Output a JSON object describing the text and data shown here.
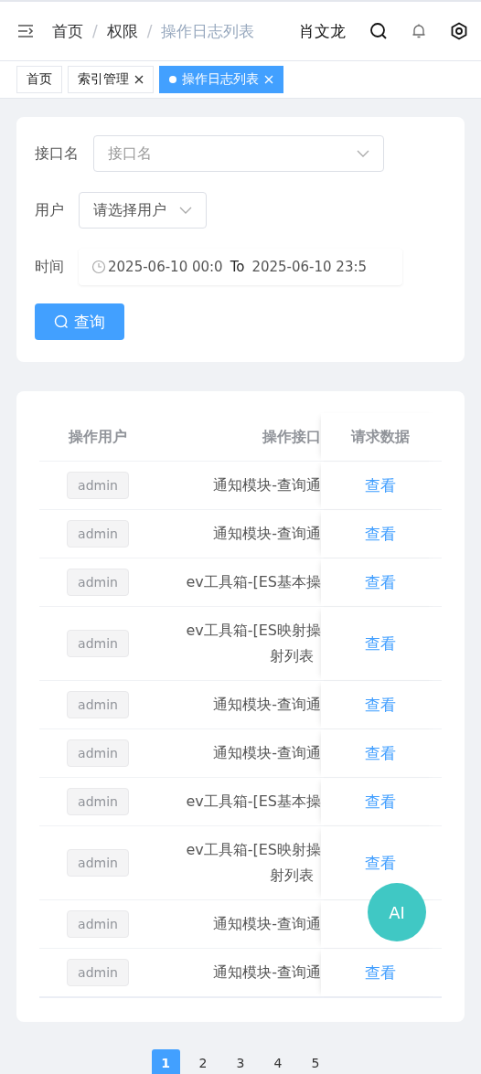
{
  "header": {
    "breadcrumb": [
      {
        "label": "首页",
        "current": false
      },
      {
        "label": "权限",
        "current": false
      },
      {
        "label": "操作日志列表",
        "current": true
      }
    ],
    "separator": "/",
    "user_name": "肖文龙"
  },
  "tabs": [
    {
      "label": "首页",
      "selected": false,
      "closable": false
    },
    {
      "label": "索引管理",
      "selected": false,
      "closable": true
    },
    {
      "label": "操作日志列表",
      "selected": true,
      "closable": true
    }
  ],
  "filters": {
    "fields": [
      {
        "kind": "select",
        "label": "接口名",
        "placeholder": "接口名",
        "wide": true
      },
      {
        "kind": "select",
        "label": "用户",
        "placeholder": "请选择用户",
        "wide": false
      },
      {
        "kind": "daterange",
        "label": "时间",
        "start": "2025-06-10 00:0",
        "separator": "To",
        "end": "2025-06-10 23:5"
      }
    ],
    "search_button": "查询"
  },
  "table": {
    "columns": [
      "操作用户",
      "操作接口",
      "请求数据"
    ],
    "rows": [
      {
        "user": "admin",
        "api": [
          "通知模块-查询通"
        ],
        "action": "查看"
      },
      {
        "user": "admin",
        "api": [
          "通知模块-查询通"
        ],
        "action": "查看"
      },
      {
        "user": "admin",
        "api": [
          "ev工具箱-[ES基本操"
        ],
        "action": "查看"
      },
      {
        "user": "admin",
        "api": [
          "ev工具箱-[ES映射操",
          "射列表"
        ],
        "action": "查看"
      },
      {
        "user": "admin",
        "api": [
          "通知模块-查询通"
        ],
        "action": "查看"
      },
      {
        "user": "admin",
        "api": [
          "通知模块-查询通"
        ],
        "action": "查看"
      },
      {
        "user": "admin",
        "api": [
          "ev工具箱-[ES基本操"
        ],
        "action": "查看"
      },
      {
        "user": "admin",
        "api": [
          "ev工具箱-[ES映射操",
          "射列表"
        ],
        "action": "查看"
      },
      {
        "user": "admin",
        "api": [
          "通知模块-查询通"
        ]
      },
      {
        "user": "admin",
        "api": [
          "通知模块-查询通"
        ],
        "action": "查看"
      }
    ]
  },
  "ai_button": "AI",
  "pagination": [
    {
      "label": "1",
      "selected": true
    },
    {
      "label": "2",
      "selected": false
    },
    {
      "label": "3",
      "selected": false
    },
    {
      "label": "4",
      "selected": false
    },
    {
      "label": "5",
      "selected": false
    }
  ]
}
